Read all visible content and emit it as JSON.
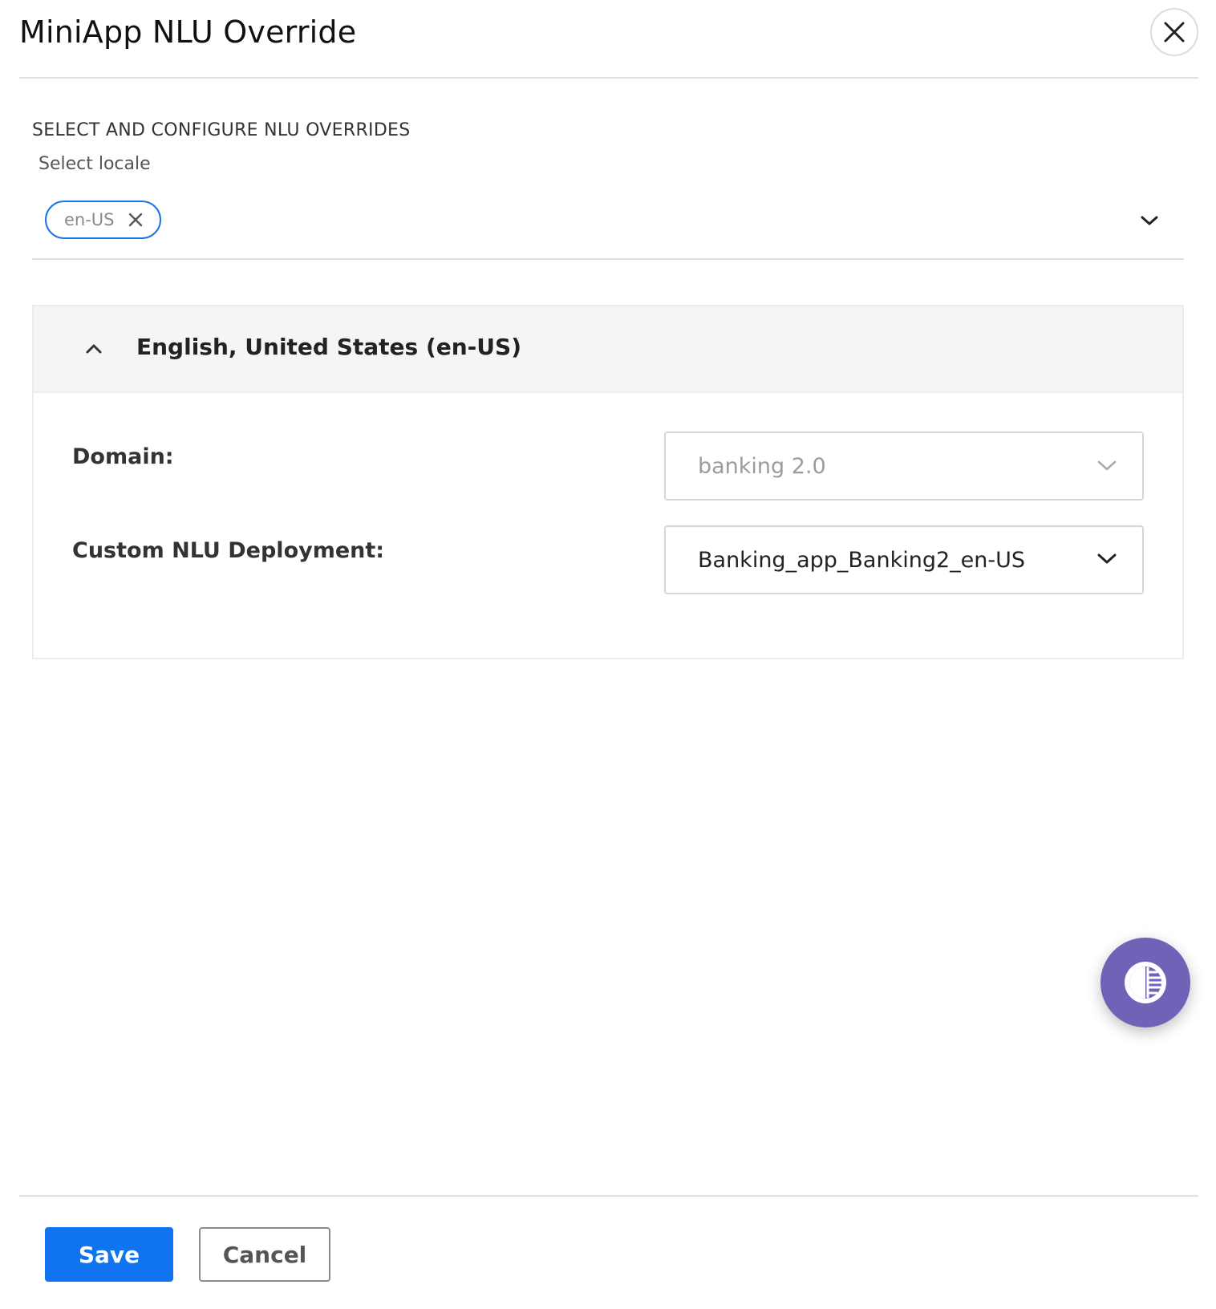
{
  "modal": {
    "title": "MiniApp NLU Override",
    "close_icon": "close-icon"
  },
  "section": {
    "heading": "SELECT AND CONFIGURE NLU OVERRIDES",
    "locale_label": "Select locale",
    "selected_locales": [
      "en-US"
    ]
  },
  "accordion": {
    "title": "English, United States (en-US)",
    "expanded": true,
    "fields": {
      "domain": {
        "label": "Domain:",
        "value": "banking 2.0",
        "disabled": true
      },
      "deployment": {
        "label": "Custom NLU Deployment:",
        "value": "Banking_app_Banking2_en-US",
        "disabled": false
      }
    }
  },
  "footer": {
    "save_label": "Save",
    "cancel_label": "Cancel"
  },
  "colors": {
    "primary": "#1073f0",
    "fab": "#6e63b6"
  },
  "icons": {
    "fab": "ai-assistant-icon"
  }
}
